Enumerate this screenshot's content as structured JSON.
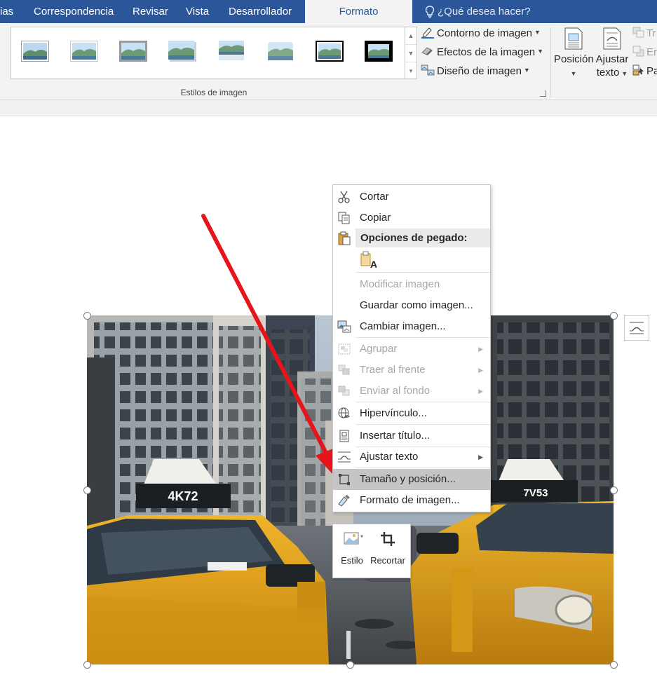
{
  "tabs": [
    {
      "label": "ias"
    },
    {
      "label": "Correspondencia"
    },
    {
      "label": "Revisar"
    },
    {
      "label": "Vista"
    },
    {
      "label": "Desarrollador"
    },
    {
      "label": "Formato",
      "active": true
    }
  ],
  "tell_me": "¿Qué desea hacer?",
  "ribbon": {
    "styles_group_label": "Estilos de imagen",
    "picture_border": "Contorno de imagen",
    "picture_effects": "Efectos de la imagen",
    "picture_layout": "Diseño de imagen",
    "position_label": "Posición",
    "wrap_text_line1": "Ajustar",
    "wrap_text_line2": "texto",
    "bring_forward_partial": "Tr",
    "send_backward_partial": "Er",
    "selection_pane_partial": "Pa"
  },
  "context_menu": {
    "cut": "Cortar",
    "copy": "Copiar",
    "paste_options": "Opciones de pegado:",
    "edit_image": "Modificar imagen",
    "save_as_image": "Guardar como imagen...",
    "change_image": "Cambiar imagen...",
    "group": "Agrupar",
    "bring_to_front": "Traer al frente",
    "send_to_back": "Enviar al fondo",
    "hyperlink": "Hipervínculo...",
    "insert_caption": "Insertar título...",
    "wrap_text": "Ajustar texto",
    "size_position": "Tamaño y posición...",
    "format_picture": "Formato de imagen..."
  },
  "mini_toolbar": {
    "style": "Estilo",
    "crop": "Recortar"
  },
  "photo": {
    "plate_left": "4K72",
    "plate_right": "7V53"
  },
  "colors": {
    "ribbon_blue": "#2b579a",
    "taxi_yellow": "#e0a81c",
    "arrow_red": "#e4161b",
    "menu_highlight": "#c5c5c5"
  }
}
